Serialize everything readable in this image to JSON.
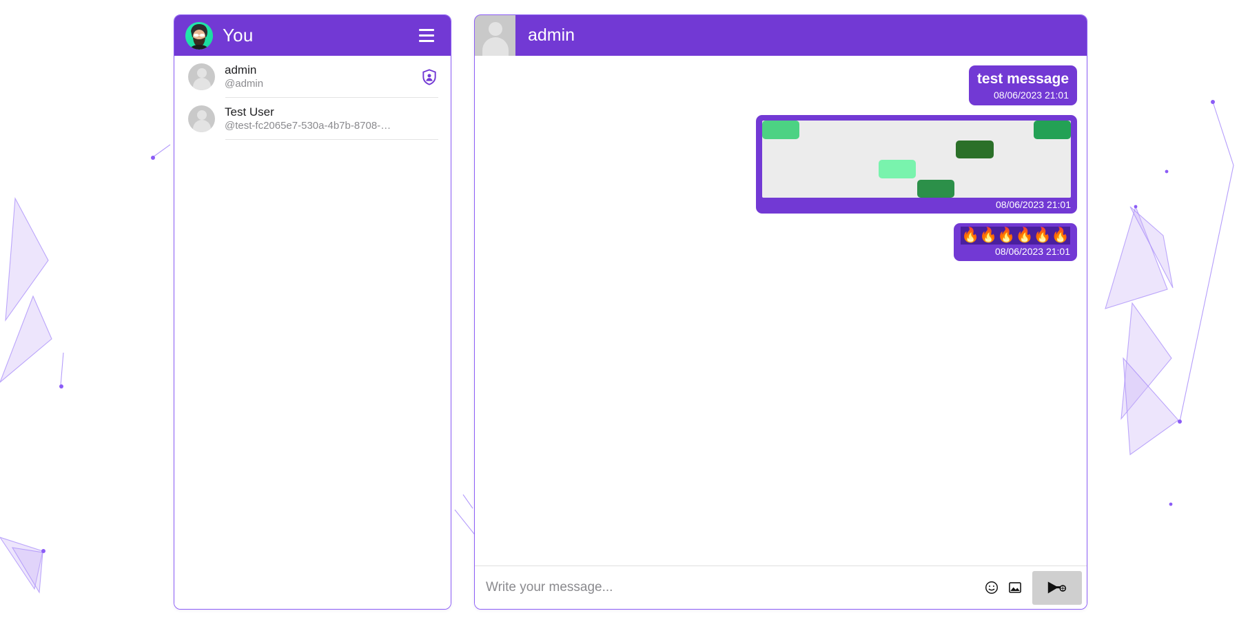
{
  "theme": {
    "accent": "#7239d4",
    "accent_border": "#8b5cf6",
    "bubble": "#7239d4",
    "emoji_strip_bg": "#4a1f9e",
    "page_bg": "#ffffff",
    "send_button_bg": "#cfcfcf",
    "grid_empty": "#ececec"
  },
  "sidebar": {
    "title": "You",
    "avatar_name": "user-photo-avatar",
    "menu_icon": "hamburger-menu-icon",
    "contacts": [
      {
        "name": "admin",
        "handle": "@admin",
        "avatar_name": "default-avatar",
        "badge_icon": "shield-person-icon",
        "has_badge": true
      },
      {
        "name": "Test User",
        "handle": "@test-fc2065e7-530a-4b7b-8708-…",
        "avatar_name": "default-avatar",
        "badge_icon": "",
        "has_badge": false
      }
    ]
  },
  "chat": {
    "title": "admin",
    "header_avatar_name": "default-avatar",
    "messages": [
      {
        "type": "text",
        "side": "out",
        "text": "test message",
        "time": "08/06/2023 21:01"
      },
      {
        "type": "image-grid",
        "side": "out",
        "time": "08/06/2023 21:01",
        "grid": {
          "columns": 8,
          "rows": 4,
          "empty_color": "#ececec",
          "cells": [
            {
              "row": 1,
              "col": 1,
              "color": "#4cd283"
            },
            {
              "row": 1,
              "col": 8,
              "color": "#23a155"
            },
            {
              "row": 2,
              "col": 6,
              "color": "#2b7029"
            },
            {
              "row": 3,
              "col": 4,
              "color": "#79f3ad"
            },
            {
              "row": 4,
              "col": 5,
              "color": "#2c9049"
            }
          ]
        }
      },
      {
        "type": "emoji",
        "side": "out",
        "text": "🔥🔥🔥🔥🔥🔥",
        "time": "08/06/2023 21:01"
      }
    ]
  },
  "composer": {
    "placeholder": "Write your message...",
    "value": "",
    "emoji_icon": "smiley-face-icon",
    "image_icon": "image-picture-icon",
    "send_icon": "send-paper-plane-icon"
  }
}
